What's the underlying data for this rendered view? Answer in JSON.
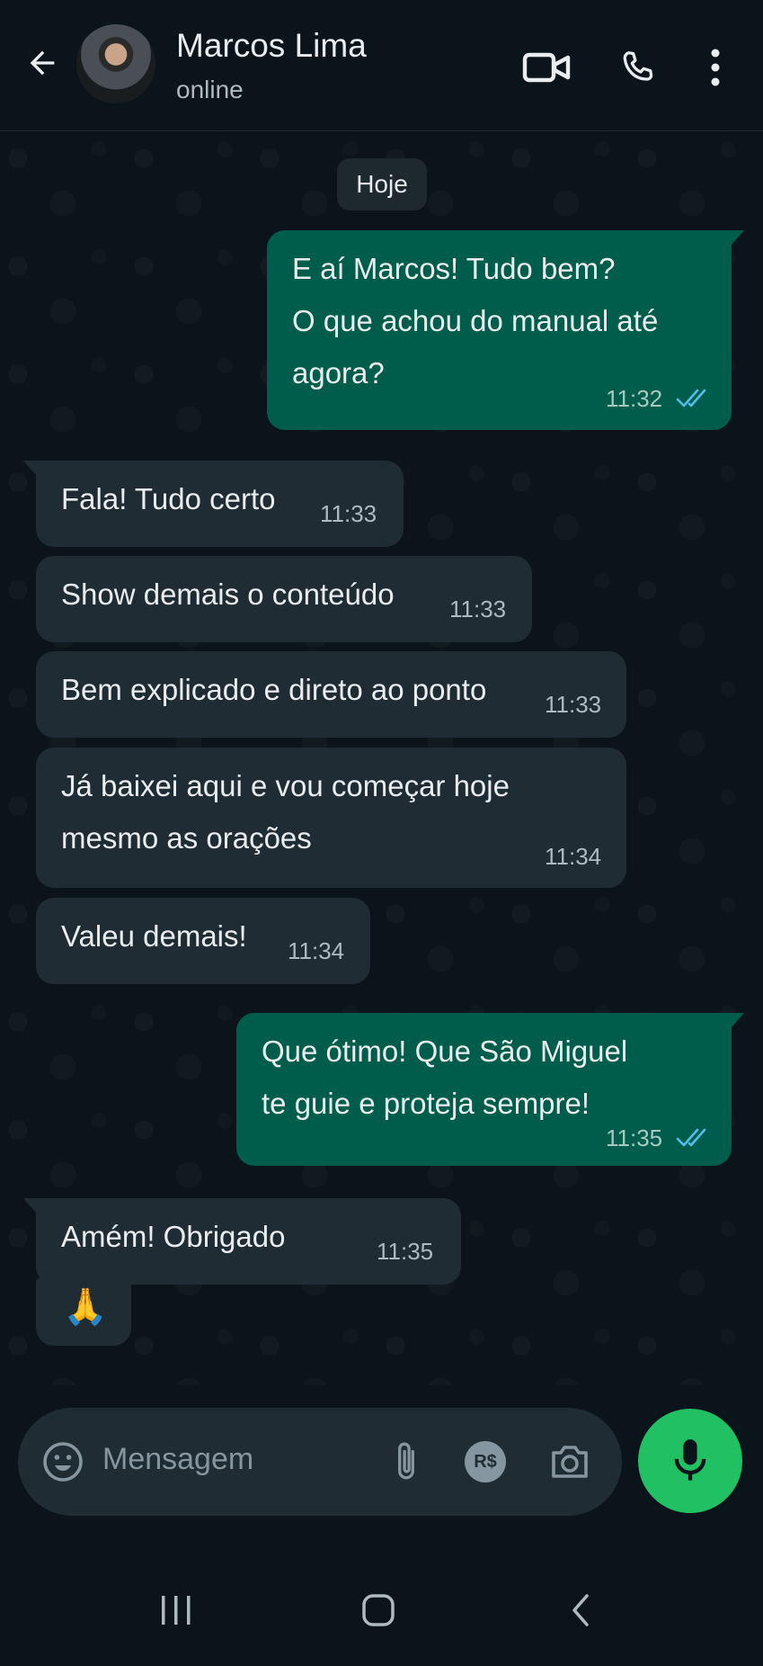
{
  "header": {
    "contact_name": "Marcos Lima",
    "status": "online",
    "icons": [
      "back-arrow-icon",
      "video-call-icon",
      "phone-icon",
      "more-options-icon"
    ]
  },
  "chat": {
    "date_separator": "Hoje",
    "messages": [
      {
        "direction": "outgoing",
        "lines": [
          "E aí Marcos! Tudo bem?",
          "O que achou do manual até",
          "agora?"
        ],
        "time": "11:32",
        "status": "read"
      },
      {
        "direction": "incoming",
        "lines": [
          "Fala! Tudo certo"
        ],
        "time": "11:33"
      },
      {
        "direction": "incoming",
        "lines": [
          "Show demais o conteúdo"
        ],
        "time": "11:33"
      },
      {
        "direction": "incoming",
        "lines": [
          "Bem explicado e direto ao ponto"
        ],
        "time": "11:33"
      },
      {
        "direction": "incoming",
        "lines": [
          "Já baixei aqui e vou começar hoje",
          "mesmo as orações"
        ],
        "time": "11:34"
      },
      {
        "direction": "incoming",
        "lines": [
          "Valeu demais!"
        ],
        "time": "11:34"
      },
      {
        "direction": "outgoing",
        "lines": [
          "Que ótimo! Que São Miguel",
          "te guie e proteja sempre!"
        ],
        "time": "11:35",
        "status": "read"
      },
      {
        "direction": "incoming",
        "lines": [
          "Amém! Obrigado"
        ],
        "time": "11:35"
      },
      {
        "direction": "incoming",
        "lines": [
          "🙏"
        ],
        "emoji": true
      }
    ]
  },
  "composer": {
    "placeholder": "Mensagem",
    "icons": [
      "emoji-icon",
      "attach-icon",
      "payment-icon",
      "camera-icon",
      "mic-icon"
    ],
    "payment_label": "R$"
  },
  "navbar": {
    "icons": [
      "recent-apps-icon",
      "home-icon",
      "back-icon"
    ]
  },
  "colors": {
    "background": "#0b141a",
    "incoming_bubble": "#1f2c34",
    "outgoing_bubble": "#005c4b",
    "read_ticks": "#53bdeb",
    "mic_button": "#21c063"
  }
}
